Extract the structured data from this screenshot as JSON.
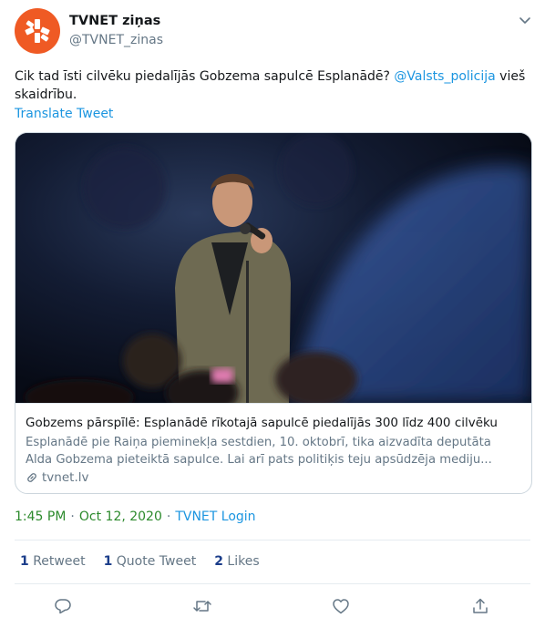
{
  "author": {
    "name": "TVNET ziņas",
    "handle": "@TVNET_zinas"
  },
  "tweet": {
    "text_before": "Cik tad īsti cilvēku piedalījās Gobzema sapulcē Esplanādē? ",
    "mention": "@Valsts_policija",
    "text_after": " vieš skaidrību.",
    "translate_label": "Translate Tweet"
  },
  "card": {
    "title": "Gobzems pārspīlē: Esplanādē rīkotajā sapulcē piedalījās 300 līdz 400 cilvēku",
    "description": "Esplanādē pie Raiņa pieminekļa sestdien, 10. oktobrī, tika aizvadīta deputāta Alda Gobzema pieteiktā sapulce. Lai arī pats politiķis teju apsūdzēja mediju...",
    "domain": "tvnet.lv"
  },
  "meta": {
    "time": "1:45 PM",
    "separator": "·",
    "date": "Oct 12, 2020",
    "source": "TVNET Login"
  },
  "stats": {
    "retweets_count": "1",
    "retweets_label": "Retweet",
    "quotes_count": "1",
    "quotes_label": "Quote Tweet",
    "likes_count": "2",
    "likes_label": "Likes"
  },
  "colors": {
    "brand_orange": "#ef5a24",
    "link_blue": "#1b95e0",
    "timestamp_green": "#2c8a2c"
  },
  "icons": [
    "tvnet-logo-icon",
    "chevron-down-icon",
    "link-icon",
    "reply-icon",
    "retweet-icon",
    "like-icon",
    "share-icon"
  ]
}
